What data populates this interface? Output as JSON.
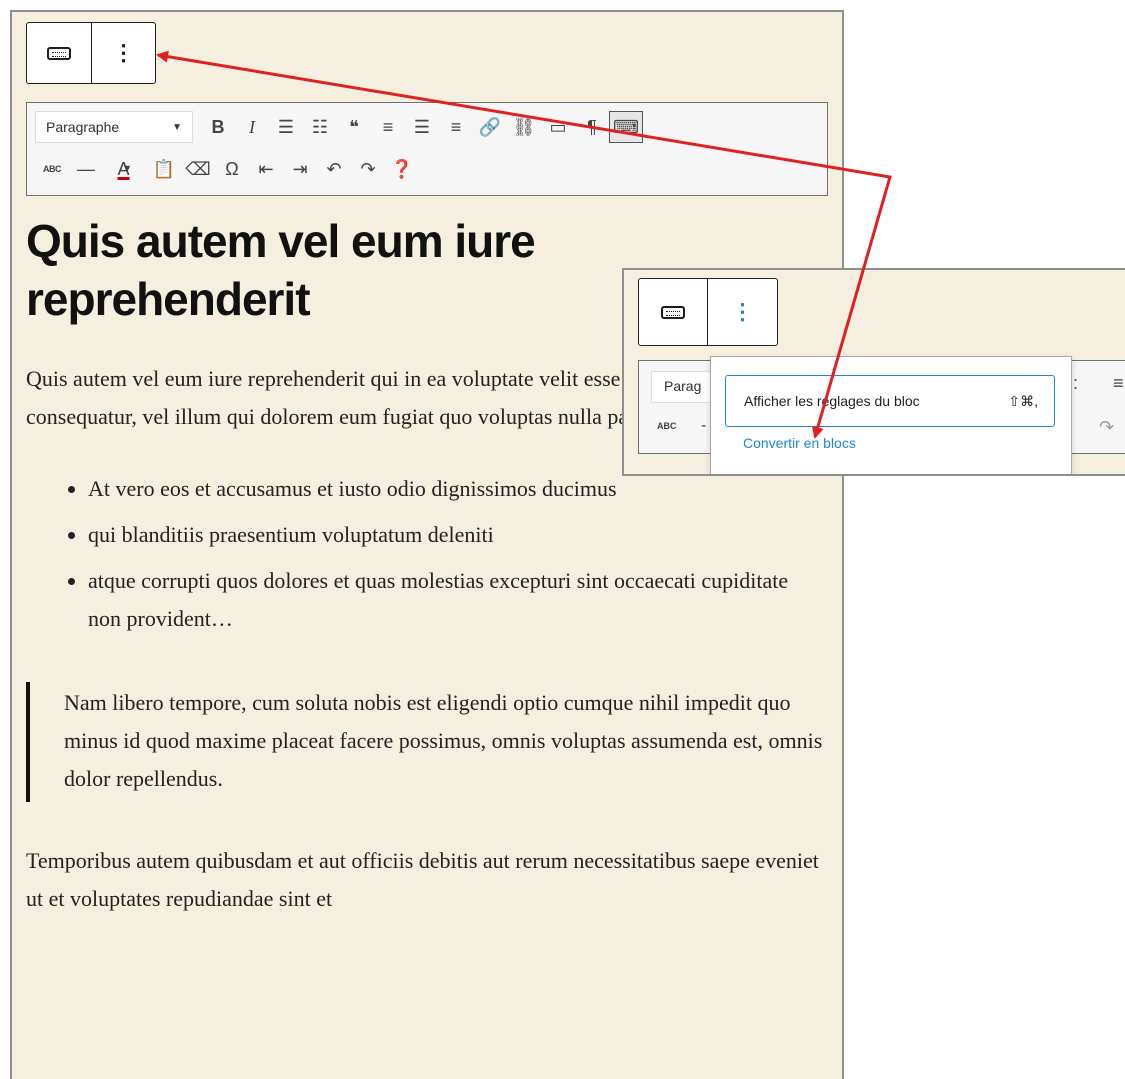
{
  "block_toolbar": {
    "keyboard_icon": "keyboard-icon",
    "more_icon": "vertical-ellipsis-icon",
    "more_glyph": "⋮"
  },
  "tinymce_toolbar": {
    "format_select": "Paragraphe",
    "format_caret": "▼",
    "row1": [
      {
        "name": "bold-button",
        "glyph": "B",
        "icon": "bold-icon"
      },
      {
        "name": "italic-button",
        "glyph": "I",
        "icon": "italic-icon"
      },
      {
        "name": "bullet-list-button",
        "glyph": "☰",
        "icon": "bullet-list-icon"
      },
      {
        "name": "numbered-list-button",
        "glyph": "☷",
        "icon": "numbered-list-icon"
      },
      {
        "name": "blockquote-button",
        "glyph": "❝",
        "icon": "blockquote-icon"
      },
      {
        "name": "align-left-button",
        "glyph": "≡",
        "icon": "align-left-icon"
      },
      {
        "name": "align-center-button",
        "glyph": "☰",
        "icon": "align-center-icon"
      },
      {
        "name": "align-right-button",
        "glyph": "≡",
        "icon": "align-right-icon"
      },
      {
        "name": "link-button",
        "glyph": "🔗",
        "icon": "link-icon"
      },
      {
        "name": "unlink-button",
        "glyph": "⛓",
        "icon": "unlink-icon"
      },
      {
        "name": "read-more-button",
        "glyph": "▭",
        "icon": "read-more-icon"
      },
      {
        "name": "code-button",
        "glyph": "¶",
        "icon": "code-icon"
      },
      {
        "name": "toolbar-toggle-button",
        "glyph": "⌨",
        "icon": "keyboard-icon"
      }
    ],
    "row2": [
      {
        "name": "strikethrough-button",
        "glyph": "ABC",
        "icon": "strikethrough-icon"
      },
      {
        "name": "horizontal-line-button",
        "glyph": "—",
        "icon": "horizontal-line-icon"
      },
      {
        "name": "text-color-button",
        "glyph": "A",
        "icon": "text-color-icon"
      },
      {
        "name": "paste-text-button",
        "glyph": "📋",
        "icon": "paste-text-icon"
      },
      {
        "name": "clear-formatting-button",
        "glyph": "⌫",
        "icon": "eraser-icon"
      },
      {
        "name": "special-character-button",
        "glyph": "Ω",
        "icon": "omega-icon"
      },
      {
        "name": "outdent-button",
        "glyph": "⇤",
        "icon": "outdent-icon"
      },
      {
        "name": "indent-button",
        "glyph": "⇥",
        "icon": "indent-icon"
      },
      {
        "name": "undo-button",
        "glyph": "↶",
        "icon": "undo-icon"
      },
      {
        "name": "redo-button",
        "glyph": "↷",
        "icon": "redo-icon"
      },
      {
        "name": "help-button",
        "glyph": "❓",
        "icon": "help-icon"
      }
    ]
  },
  "content": {
    "heading": "Quis autem vel eum iure reprehenderit",
    "paragraph1": "Quis autem vel eum iure reprehenderit qui in ea voluptate velit esse quam nihil molestiae consequatur, vel illum qui dolorem eum fugiat quo voluptas nulla pariatur?",
    "list": [
      "At vero eos et accusamus et iusto odio dignissimos ducimus",
      "qui blanditiis praesentium voluptatum deleniti",
      "atque corrupti quos dolores et quas molestias excepturi sint occaecati cupiditate non provident…"
    ],
    "quote": "Nam libero tempore, cum soluta nobis est eligendi optio cumque nihil impedit quo minus id quod maxime placeat facere possimus, omnis voluptas assumenda est, omnis dolor repellendus.",
    "paragraph2": "Temporibus autem quibusdam et aut officiis debitis aut rerum necessitatibus saepe eveniet ut et voluptates repudiandae sint et"
  },
  "zoom": {
    "format_select": "Parag",
    "strikethrough_glyph": "ABC",
    "dash_glyph": "-",
    "right_glyph1": ":",
    "right_glyph2": "≡",
    "redo_glyph": "↷",
    "menu": {
      "item1_label": "Afficher les réglages du bloc",
      "item1_shortcut": "⇧⌘,",
      "item2_label": "Convertir en blocs"
    }
  },
  "colors": {
    "arrow": "#e02020",
    "accent": "#1e88d6",
    "editor_bg": "#f5efe0"
  }
}
